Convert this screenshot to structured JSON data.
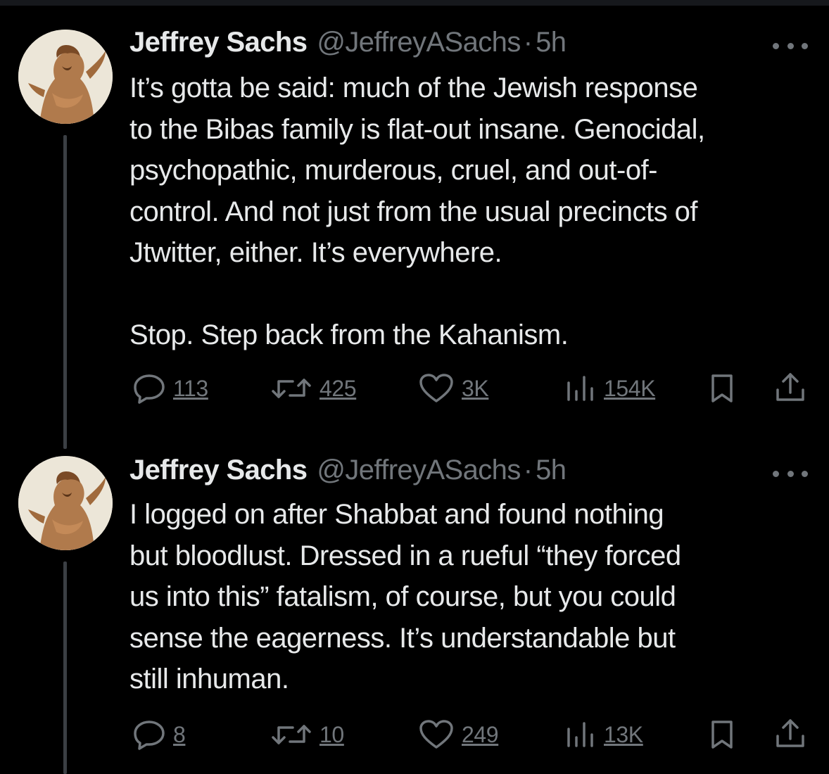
{
  "colors": {
    "background": "#000000",
    "text_primary": "#e7e9ea",
    "text_secondary": "#71767b",
    "thread_line": "#3b3f44"
  },
  "tweets": [
    {
      "author": {
        "name": "Jeffrey Sachs",
        "handle": "@JeffreyASachs",
        "separator": "·",
        "time": "5h"
      },
      "text_lines": [
        "It’s gotta be said: much of the Jewish response",
        "to the Bibas family is flat-out insane. Genocidal,",
        "psychopathic, murderous, cruel, and out-of-",
        "control. And not just from the usual precincts of",
        "Jtwitter, either. It’s everywhere."
      ],
      "text_final": "Stop. Step back from the Kahanism.",
      "actions": {
        "replies": "113",
        "reposts": "425",
        "likes": "3K",
        "views": "154K"
      }
    },
    {
      "author": {
        "name": "Jeffrey Sachs",
        "handle": "@JeffreyASachs",
        "separator": "·",
        "time": "5h"
      },
      "text_lines": [
        "I logged on after Shabbat and found nothing",
        "but bloodlust. Dressed in a rueful “they forced",
        "us into this” fatalism, of course, but you could",
        "sense the eagerness. It’s understandable but",
        "still inhuman."
      ],
      "actions": {
        "replies": "8",
        "reposts": "10",
        "likes": "249",
        "views": "13K"
      }
    }
  ],
  "icons": {
    "reply": "reply-icon",
    "repost": "repost-icon",
    "like": "heart-icon",
    "views": "views-icon",
    "bookmark": "bookmark-icon",
    "share": "share-icon",
    "more": "more-icon"
  }
}
